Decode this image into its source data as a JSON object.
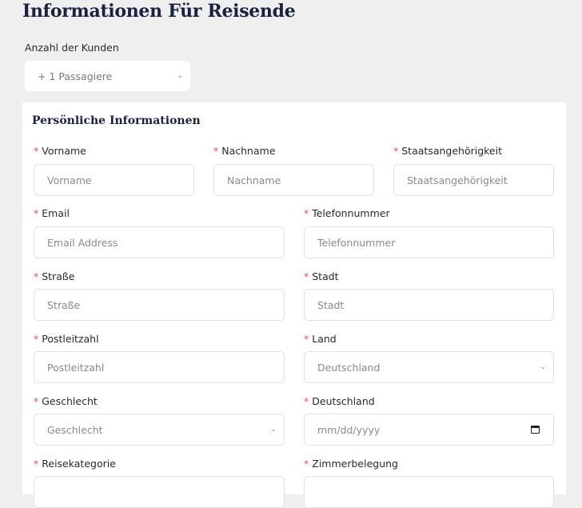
{
  "page": {
    "title": "Informationen Für Reisende"
  },
  "customers": {
    "label": "Anzahl der Kunden",
    "value": "+ 1 Passagiere"
  },
  "section": {
    "title": "Persönliche Informationen"
  },
  "required_marker": "*",
  "fields": {
    "vorname": {
      "label": "Vorname",
      "placeholder": "Vorname"
    },
    "nachname": {
      "label": "Nachname",
      "placeholder": "Nachname"
    },
    "staat": {
      "label": "Staatsangehörigkeit",
      "placeholder": "Staatsangehörigkeit"
    },
    "email": {
      "label": "Email",
      "placeholder": "Email Address"
    },
    "telefon": {
      "label": "Telefonnummer",
      "placeholder": "Telefonnummer"
    },
    "strasse": {
      "label": "Straße",
      "placeholder": "Straße"
    },
    "stadt": {
      "label": "Stadt",
      "placeholder": "Stadt"
    },
    "plz": {
      "label": "Postleitzahl",
      "placeholder": "Postleitzahl"
    },
    "land": {
      "label": "Land",
      "value": "Deutschland"
    },
    "geschlecht": {
      "label": "Geschlecht",
      "value": "Geschlecht"
    },
    "datum": {
      "label": "Deutschland",
      "value": "mm/dd/yyyy"
    },
    "reisekategorie": {
      "label": "Reisekategorie"
    },
    "zimmer": {
      "label": "Zimmerbelegung"
    }
  },
  "icons": {
    "chevron": "chevron-down-icon",
    "calendar": "calendar-icon"
  }
}
